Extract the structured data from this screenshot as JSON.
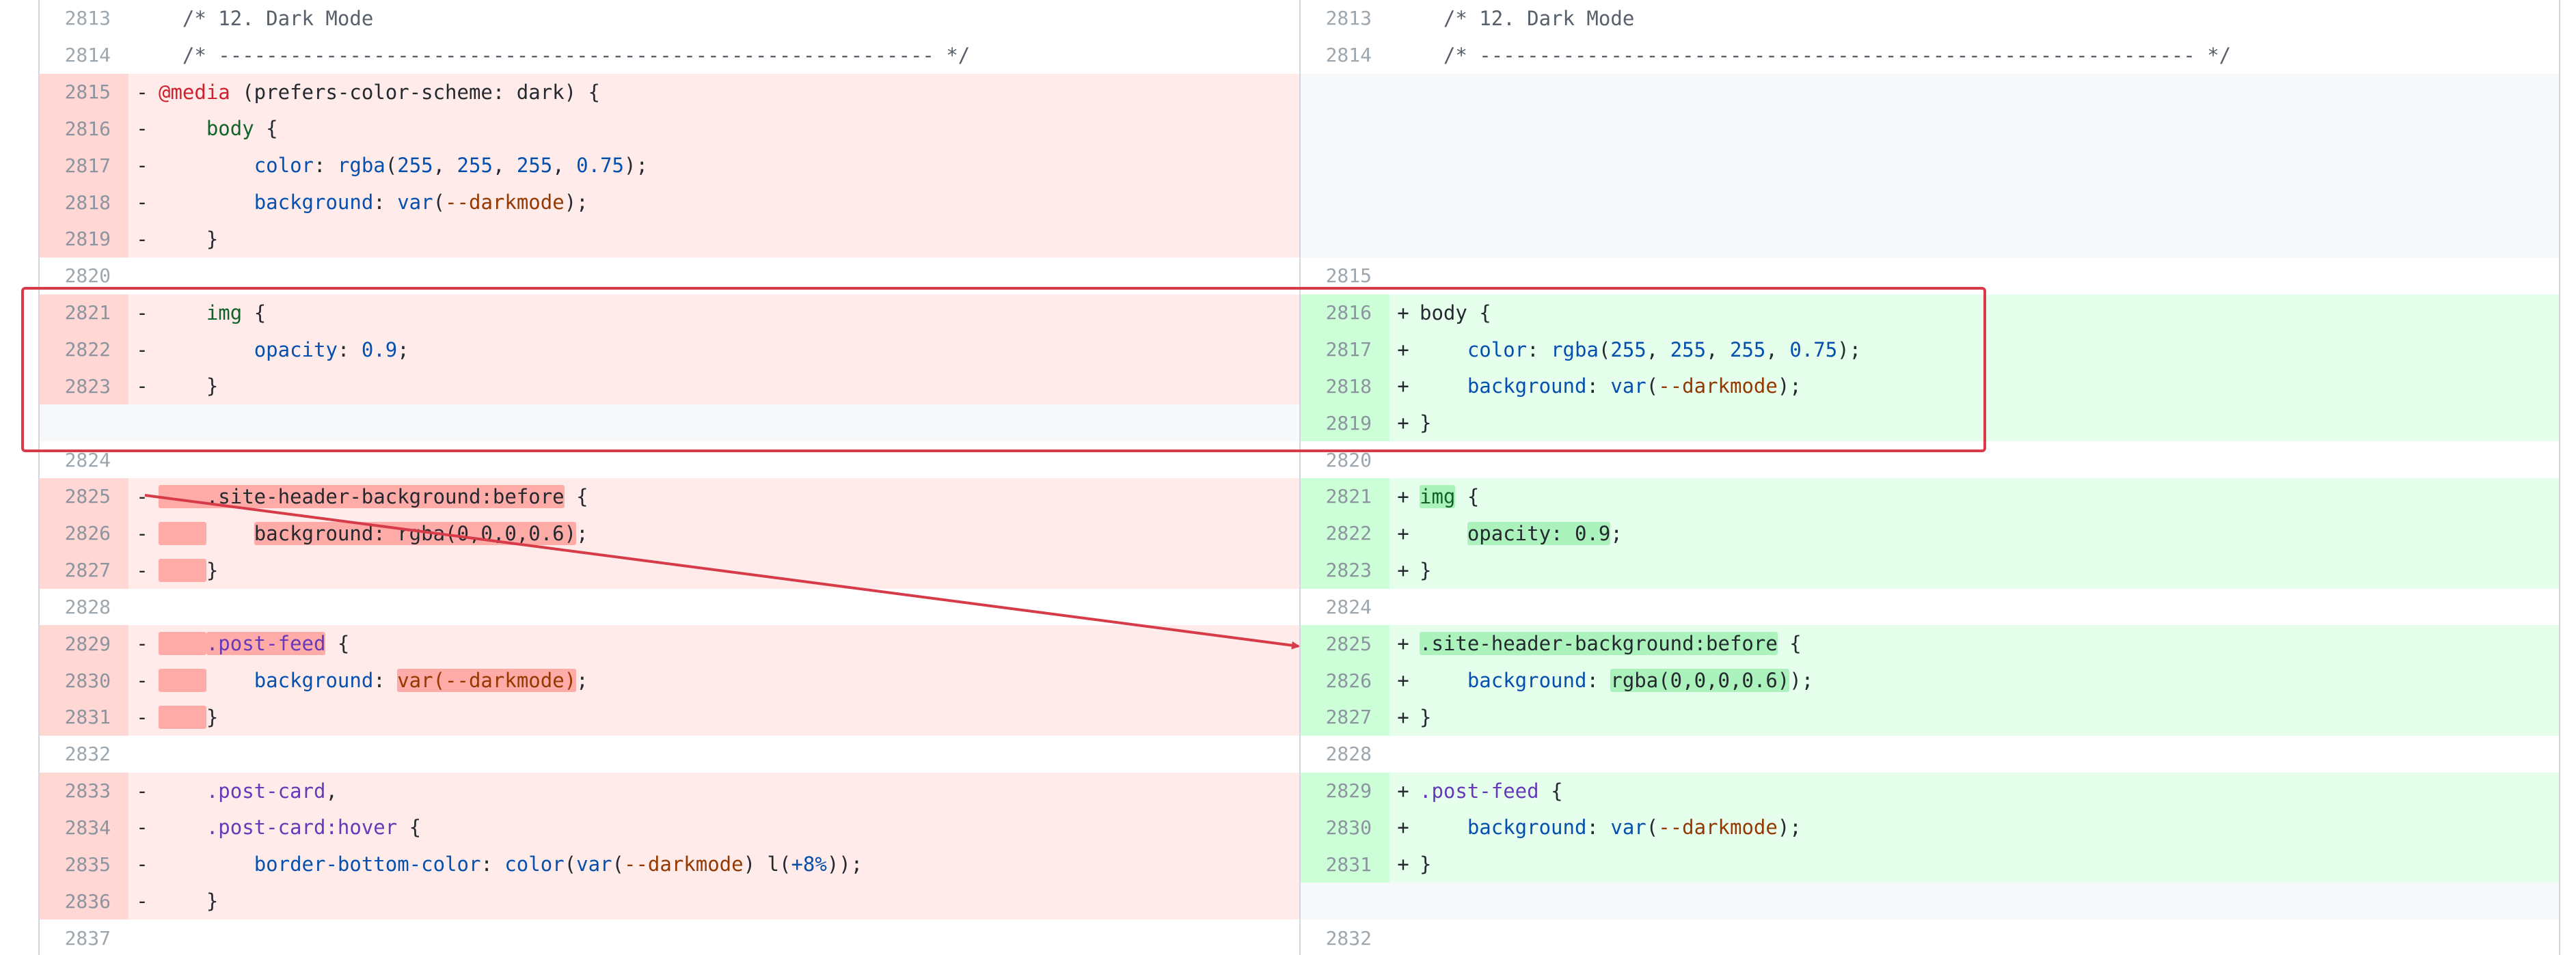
{
  "diff": {
    "left": [
      {
        "type": "ctx",
        "num": "2813",
        "sign": "",
        "tokens": [
          {
            "t": "  ",
            "c": "plain"
          },
          {
            "t": "/* 12. Dark Mode",
            "c": "comment"
          }
        ]
      },
      {
        "type": "ctx",
        "num": "2814",
        "sign": "",
        "tokens": [
          {
            "t": "  ",
            "c": "plain"
          },
          {
            "t": "/* ------------------------------------------------------------ */",
            "c": "comment"
          }
        ]
      },
      {
        "type": "del",
        "num": "2815",
        "sign": "-",
        "tokens": [
          {
            "t": "@media",
            "c": "at"
          },
          {
            "t": " (prefers-color-scheme: dark) {",
            "c": "plain"
          }
        ]
      },
      {
        "type": "del",
        "num": "2816",
        "sign": "-",
        "tokens": [
          {
            "t": "    ",
            "c": "plain"
          },
          {
            "t": "body",
            "c": "sel"
          },
          {
            "t": " {",
            "c": "plain"
          }
        ]
      },
      {
        "type": "del",
        "num": "2817",
        "sign": "-",
        "tokens": [
          {
            "t": "        ",
            "c": "plain"
          },
          {
            "t": "color",
            "c": "prop"
          },
          {
            "t": ": ",
            "c": "plain"
          },
          {
            "t": "rgba",
            "c": "fn"
          },
          {
            "t": "(",
            "c": "plain"
          },
          {
            "t": "255",
            "c": "num"
          },
          {
            "t": ", ",
            "c": "plain"
          },
          {
            "t": "255",
            "c": "num"
          },
          {
            "t": ", ",
            "c": "plain"
          },
          {
            "t": "255",
            "c": "num"
          },
          {
            "t": ", ",
            "c": "plain"
          },
          {
            "t": "0.75",
            "c": "num"
          },
          {
            "t": ");",
            "c": "plain"
          }
        ]
      },
      {
        "type": "del",
        "num": "2818",
        "sign": "-",
        "tokens": [
          {
            "t": "        ",
            "c": "plain"
          },
          {
            "t": "background",
            "c": "prop"
          },
          {
            "t": ": ",
            "c": "plain"
          },
          {
            "t": "var",
            "c": "fn"
          },
          {
            "t": "(",
            "c": "plain"
          },
          {
            "t": "--darkmode",
            "c": "var"
          },
          {
            "t": ");",
            "c": "plain"
          }
        ]
      },
      {
        "type": "del",
        "num": "2819",
        "sign": "-",
        "tokens": [
          {
            "t": "    }",
            "c": "plain"
          }
        ]
      },
      {
        "type": "ctx",
        "num": "2820",
        "sign": "",
        "tokens": []
      },
      {
        "type": "del",
        "num": "2821",
        "sign": "-",
        "tokens": [
          {
            "t": "    ",
            "c": "plain"
          },
          {
            "t": "img",
            "c": "sel"
          },
          {
            "t": " {",
            "c": "plain"
          }
        ]
      },
      {
        "type": "del",
        "num": "2822",
        "sign": "-",
        "tokens": [
          {
            "t": "        ",
            "c": "plain"
          },
          {
            "t": "opacity",
            "c": "prop"
          },
          {
            "t": ": ",
            "c": "plain"
          },
          {
            "t": "0.9",
            "c": "num"
          },
          {
            "t": ";",
            "c": "plain"
          }
        ]
      },
      {
        "type": "del",
        "num": "2823",
        "sign": "-",
        "tokens": [
          {
            "t": "    }",
            "c": "plain"
          }
        ]
      },
      {
        "type": "empty",
        "num": "",
        "sign": "",
        "tokens": []
      },
      {
        "type": "ctx",
        "num": "2824",
        "sign": "",
        "tokens": []
      },
      {
        "type": "del",
        "num": "2825",
        "sign": "-",
        "tokens": [
          {
            "t": "    .site-header-background:before",
            "c": "plain",
            "hl": true
          },
          {
            "t": " {",
            "c": "plain"
          }
        ]
      },
      {
        "type": "del",
        "num": "2826",
        "sign": "-",
        "tokens": [
          {
            "t": "    ",
            "c": "plain",
            "hl": true
          },
          {
            "t": "    ",
            "c": "plain"
          },
          {
            "t": "background: rgba(0,0,0,0.6)",
            "c": "plain",
            "hl": true
          },
          {
            "t": ";",
            "c": "plain"
          }
        ]
      },
      {
        "type": "del",
        "num": "2827",
        "sign": "-",
        "tokens": [
          {
            "t": "    ",
            "c": "plain",
            "hl": true
          },
          {
            "t": "}",
            "c": "plain"
          }
        ]
      },
      {
        "type": "ctx",
        "num": "2828",
        "sign": "",
        "tokens": []
      },
      {
        "type": "del",
        "num": "2829",
        "sign": "-",
        "tokens": [
          {
            "t": "    ",
            "c": "plain",
            "hl": true
          },
          {
            "t": ".post-feed",
            "c": "cls",
            "hl": true
          },
          {
            "t": " {",
            "c": "plain"
          }
        ]
      },
      {
        "type": "del",
        "num": "2830",
        "sign": "-",
        "tokens": [
          {
            "t": "    ",
            "c": "plain",
            "hl": true
          },
          {
            "t": "    ",
            "c": "plain"
          },
          {
            "t": "background",
            "c": "prop"
          },
          {
            "t": ": ",
            "c": "plain"
          },
          {
            "t": "var(--darkmode)",
            "c": "var",
            "hl": true
          },
          {
            "t": ";",
            "c": "plain"
          }
        ]
      },
      {
        "type": "del",
        "num": "2831",
        "sign": "-",
        "tokens": [
          {
            "t": "    ",
            "c": "plain",
            "hl": true
          },
          {
            "t": "}",
            "c": "plain"
          }
        ]
      },
      {
        "type": "ctx",
        "num": "2832",
        "sign": "",
        "tokens": []
      },
      {
        "type": "del",
        "num": "2833",
        "sign": "-",
        "tokens": [
          {
            "t": "    ",
            "c": "plain"
          },
          {
            "t": ".post-card",
            "c": "cls"
          },
          {
            "t": ",",
            "c": "plain"
          }
        ]
      },
      {
        "type": "del",
        "num": "2834",
        "sign": "-",
        "tokens": [
          {
            "t": "    ",
            "c": "plain"
          },
          {
            "t": ".post-card:hover",
            "c": "cls"
          },
          {
            "t": " {",
            "c": "plain"
          }
        ]
      },
      {
        "type": "del",
        "num": "2835",
        "sign": "-",
        "tokens": [
          {
            "t": "        ",
            "c": "plain"
          },
          {
            "t": "border-bottom-color",
            "c": "prop"
          },
          {
            "t": ": ",
            "c": "plain"
          },
          {
            "t": "color",
            "c": "fn"
          },
          {
            "t": "(",
            "c": "plain"
          },
          {
            "t": "var",
            "c": "fn"
          },
          {
            "t": "(",
            "c": "plain"
          },
          {
            "t": "--darkmode",
            "c": "var"
          },
          {
            "t": ") l(",
            "c": "plain"
          },
          {
            "t": "+8%",
            "c": "num"
          },
          {
            "t": "));",
            "c": "plain"
          }
        ]
      },
      {
        "type": "del",
        "num": "2836",
        "sign": "-",
        "tokens": [
          {
            "t": "    }",
            "c": "plain"
          }
        ]
      },
      {
        "type": "ctx",
        "num": "2837",
        "sign": "",
        "tokens": []
      }
    ],
    "right": [
      {
        "type": "ctx",
        "num": "2813",
        "sign": "",
        "tokens": [
          {
            "t": "  ",
            "c": "plain"
          },
          {
            "t": "/* 12. Dark Mode",
            "c": "comment"
          }
        ]
      },
      {
        "type": "ctx",
        "num": "2814",
        "sign": "",
        "tokens": [
          {
            "t": "  ",
            "c": "plain"
          },
          {
            "t": "/* ------------------------------------------------------------ */",
            "c": "comment"
          }
        ]
      },
      {
        "type": "empty",
        "num": "",
        "sign": "",
        "tokens": []
      },
      {
        "type": "empty",
        "num": "",
        "sign": "",
        "tokens": []
      },
      {
        "type": "empty",
        "num": "",
        "sign": "",
        "tokens": []
      },
      {
        "type": "empty",
        "num": "",
        "sign": "",
        "tokens": []
      },
      {
        "type": "empty",
        "num": "",
        "sign": "",
        "tokens": []
      },
      {
        "type": "ctx",
        "num": "2815",
        "sign": "",
        "tokens": []
      },
      {
        "type": "add",
        "num": "2816",
        "sign": "+",
        "tokens": [
          {
            "t": "body",
            "c": "plain"
          },
          {
            "t": " {",
            "c": "plain"
          }
        ]
      },
      {
        "type": "add",
        "num": "2817",
        "sign": "+",
        "tokens": [
          {
            "t": "    ",
            "c": "plain"
          },
          {
            "t": "color",
            "c": "prop"
          },
          {
            "t": ": ",
            "c": "plain"
          },
          {
            "t": "rgba",
            "c": "fn"
          },
          {
            "t": "(",
            "c": "plain"
          },
          {
            "t": "255",
            "c": "num"
          },
          {
            "t": ", ",
            "c": "plain"
          },
          {
            "t": "255",
            "c": "num"
          },
          {
            "t": ", ",
            "c": "plain"
          },
          {
            "t": "255",
            "c": "num"
          },
          {
            "t": ", ",
            "c": "plain"
          },
          {
            "t": "0.75",
            "c": "num"
          },
          {
            "t": ");",
            "c": "plain"
          }
        ]
      },
      {
        "type": "add",
        "num": "2818",
        "sign": "+",
        "tokens": [
          {
            "t": "    ",
            "c": "plain"
          },
          {
            "t": "background",
            "c": "prop"
          },
          {
            "t": ": ",
            "c": "plain"
          },
          {
            "t": "var",
            "c": "fn"
          },
          {
            "t": "(",
            "c": "plain"
          },
          {
            "t": "--darkmode",
            "c": "var"
          },
          {
            "t": ");",
            "c": "plain"
          }
        ]
      },
      {
        "type": "add",
        "num": "2819",
        "sign": "+",
        "tokens": [
          {
            "t": "}",
            "c": "plain"
          }
        ]
      },
      {
        "type": "ctx",
        "num": "2820",
        "sign": "",
        "tokens": []
      },
      {
        "type": "add",
        "num": "2821",
        "sign": "+",
        "tokens": [
          {
            "t": "img",
            "c": "sel",
            "hl": true
          },
          {
            "t": " {",
            "c": "plain"
          }
        ]
      },
      {
        "type": "add",
        "num": "2822",
        "sign": "+",
        "tokens": [
          {
            "t": "    ",
            "c": "plain"
          },
          {
            "t": "opacity: 0.9",
            "c": "plain",
            "hl": true
          },
          {
            "t": ";",
            "c": "plain"
          }
        ]
      },
      {
        "type": "add",
        "num": "2823",
        "sign": "+",
        "tokens": [
          {
            "t": "}",
            "c": "plain"
          }
        ]
      },
      {
        "type": "ctx",
        "num": "2824",
        "sign": "",
        "tokens": []
      },
      {
        "type": "add",
        "num": "2825",
        "sign": "+",
        "tokens": [
          {
            "t": ".site-header-background:before",
            "c": "plain",
            "hl": true
          },
          {
            "t": " {",
            "c": "plain"
          }
        ]
      },
      {
        "type": "add",
        "num": "2826",
        "sign": "+",
        "tokens": [
          {
            "t": "    ",
            "c": "plain"
          },
          {
            "t": "background",
            "c": "prop"
          },
          {
            "t": ": ",
            "c": "plain"
          },
          {
            "t": "rgba(0,0,0,0.6)",
            "c": "plain",
            "hl": true
          },
          {
            "t": ");",
            "c": "plain"
          }
        ]
      },
      {
        "type": "add",
        "num": "2827",
        "sign": "+",
        "tokens": [
          {
            "t": "}",
            "c": "plain"
          }
        ]
      },
      {
        "type": "ctx",
        "num": "2828",
        "sign": "",
        "tokens": []
      },
      {
        "type": "add",
        "num": "2829",
        "sign": "+",
        "tokens": [
          {
            "t": ".post-feed",
            "c": "cls"
          },
          {
            "t": " {",
            "c": "plain"
          }
        ]
      },
      {
        "type": "add",
        "num": "2830",
        "sign": "+",
        "tokens": [
          {
            "t": "    ",
            "c": "plain"
          },
          {
            "t": "background",
            "c": "prop"
          },
          {
            "t": ": ",
            "c": "plain"
          },
          {
            "t": "var",
            "c": "fn"
          },
          {
            "t": "(",
            "c": "plain"
          },
          {
            "t": "--darkmode",
            "c": "var"
          },
          {
            "t": ");",
            "c": "plain"
          }
        ]
      },
      {
        "type": "add",
        "num": "2831",
        "sign": "+",
        "tokens": [
          {
            "t": "}",
            "c": "plain"
          }
        ]
      },
      {
        "type": "empty",
        "num": "",
        "sign": "",
        "tokens": []
      },
      {
        "type": "ctx",
        "num": "2832",
        "sign": "",
        "tokens": []
      }
    ]
  },
  "annotations": {
    "box_color": "#d73a49",
    "arrow_color": "#d73a49"
  },
  "colors": {
    "deletion_bg": "#ffebe9",
    "addition_bg": "#e6ffec",
    "deletion_highlight": "#ffaba8",
    "addition_highlight": "#abf2bc"
  }
}
